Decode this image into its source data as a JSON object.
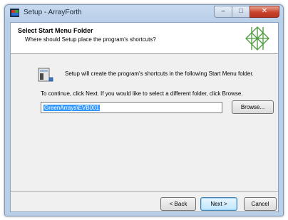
{
  "window": {
    "title": "Setup - ArrayForth",
    "buttons": {
      "minimize": "–",
      "maximize": "□",
      "close": "✕"
    }
  },
  "header": {
    "title": "Select Start Menu Folder",
    "subtitle": "Where should Setup place the program's shortcuts?",
    "logo_icon": "wizard-star-icon"
  },
  "body": {
    "info_text": "Setup will create the program's shortcuts in the following Start Menu folder.",
    "continue_text": "To continue, click Next. If you would like to select a different folder, click Browse.",
    "folder_value": "GreenArrays\\EVB001",
    "browse_label": "Browse..."
  },
  "footer": {
    "back_label": "< Back",
    "next_label": "Next >",
    "cancel_label": "Cancel"
  },
  "colors": {
    "selection": "#3399ff",
    "logo_green": "#4a9a3a",
    "title_bar": "#b9cfe8"
  }
}
